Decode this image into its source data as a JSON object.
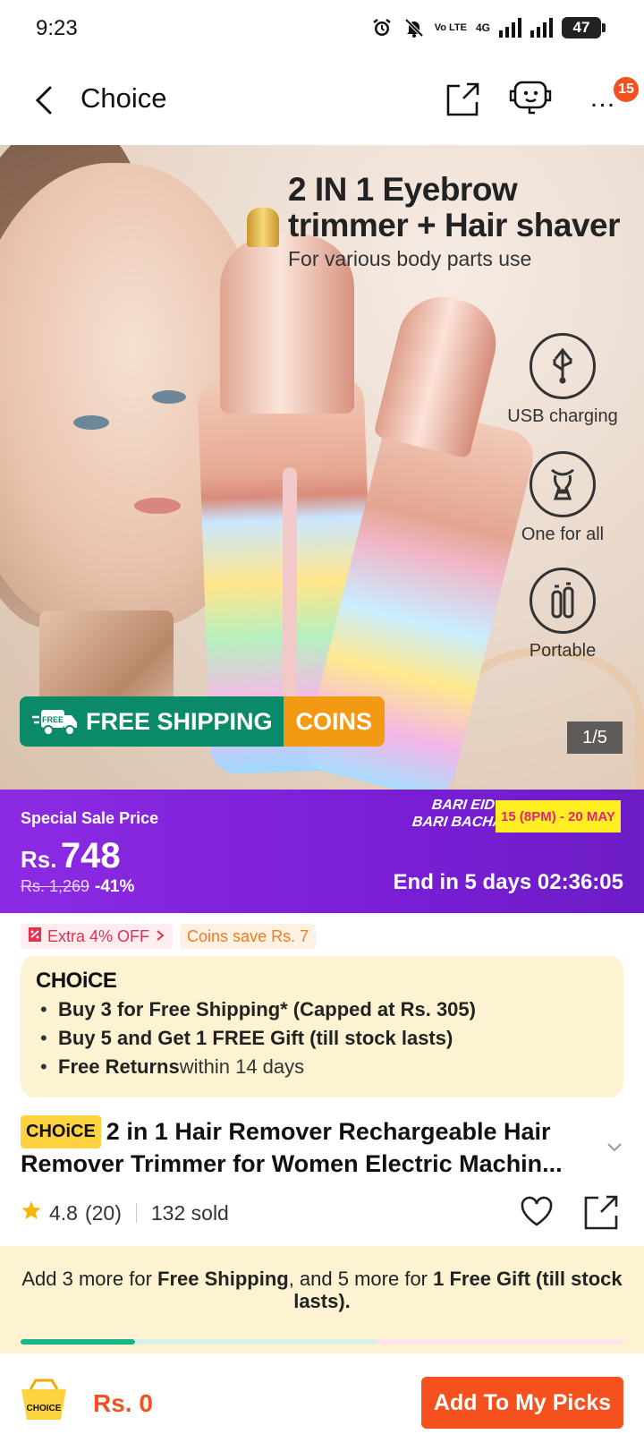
{
  "status_bar": {
    "time": "9:23",
    "volte": "Vo LTE",
    "network": "4G",
    "battery": "47",
    "icons": [
      "alarm-icon",
      "mute-icon",
      "volte-icon",
      "signal-icon",
      "signal-icon",
      "battery-icon"
    ]
  },
  "header": {
    "title": "Choice",
    "badge_count": "15",
    "more": "…",
    "icons": [
      "back-icon",
      "share-icon",
      "support-bot-icon",
      "more-icon"
    ]
  },
  "hero": {
    "headline": "2 IN 1 Eyebrow trimmer + Hair shaver",
    "subline": "For various body parts use",
    "features": [
      "USB charging",
      "One for all",
      "Portable"
    ],
    "free_shipping": "FREE SHIPPING",
    "free_tag": "FREE",
    "coins": "COINS",
    "counter": "1/5"
  },
  "sale": {
    "label": "Special Sale Price",
    "currency": "Rs.",
    "price": "748",
    "old_price": "Rs. 1,269",
    "discount": "-41%",
    "event_line1": "BARI EID",
    "event_line2": "BARI BACHAT",
    "event_dates": "15 (8PM) - 20 MAY",
    "timer": "End in 5 days 02:36:05"
  },
  "coupons": {
    "extra_off": "Extra 4% OFF",
    "coins_save": "Coins save Rs. 7"
  },
  "choice_box": {
    "logo": "CHOiCE",
    "items": [
      {
        "bold": "Buy 3 for  Free Shipping* (Capped at Rs. 305)",
        "rest": ""
      },
      {
        "bold": "Buy 5 and Get 1 FREE Gift (till stock lasts)",
        "rest": ""
      },
      {
        "bold": "Free Returns",
        "rest": " within 14 days"
      }
    ]
  },
  "product": {
    "tag": "CHOiCE",
    "title": "2 in 1 Hair Remover Rechargeable Hair Remover Trimmer for Women Electric Machin...",
    "rating": "4.8",
    "reviews": "(20)",
    "sold": "132 sold"
  },
  "upsell": {
    "part1": "Add 3 more for ",
    "bold1": "Free Shipping",
    "part2": ", and 5 more for ",
    "bold2": "1 Free Gift (till stock lasts).",
    "progress": 0.19
  },
  "bottom": {
    "cart_label": "CHOICE",
    "total": "Rs. 0",
    "add_button": "Add To My Picks"
  },
  "colors": {
    "accent": "#f4511e",
    "sale_purple": "#7b1fd8",
    "choice_yellow": "#ffd23f",
    "free_shipping_green": "#0b8a6a",
    "coins_orange": "#f29a14"
  }
}
